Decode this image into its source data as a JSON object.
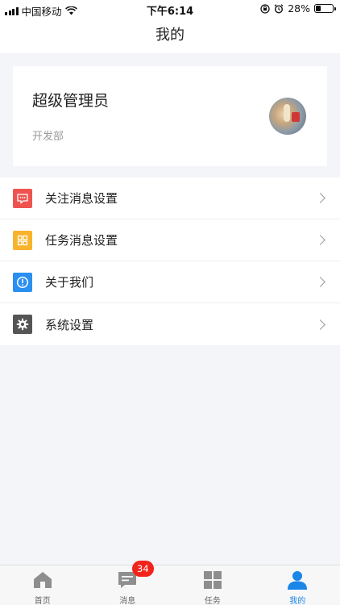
{
  "status_bar": {
    "carrier": "中国移动",
    "time": "下午6:14",
    "battery": "28%",
    "battery_level": 0.28
  },
  "nav": {
    "title": "我的"
  },
  "profile": {
    "name": "超级管理员",
    "department": "开发部"
  },
  "menu": {
    "items": [
      {
        "label": "关注消息设置",
        "icon": "message-icon",
        "color": "#ef5350"
      },
      {
        "label": "任务消息设置",
        "icon": "grid-icon",
        "color": "#f7b32b"
      },
      {
        "label": "关于我们",
        "icon": "info-icon",
        "color": "#2a8ff0"
      },
      {
        "label": "系统设置",
        "icon": "gear-icon",
        "color": "#555555"
      }
    ]
  },
  "tabbar": {
    "tabs": [
      {
        "label": "首页",
        "icon": "home-icon"
      },
      {
        "label": "消息",
        "icon": "chat-icon"
      },
      {
        "label": "任务",
        "icon": "grid-icon"
      },
      {
        "label": "我的",
        "icon": "person-icon",
        "active": true
      }
    ],
    "message_badge": "34"
  },
  "colors": {
    "accent": "#1a86e8",
    "badge": "#f2231b",
    "tab_inactive": "#8e8e8e"
  }
}
